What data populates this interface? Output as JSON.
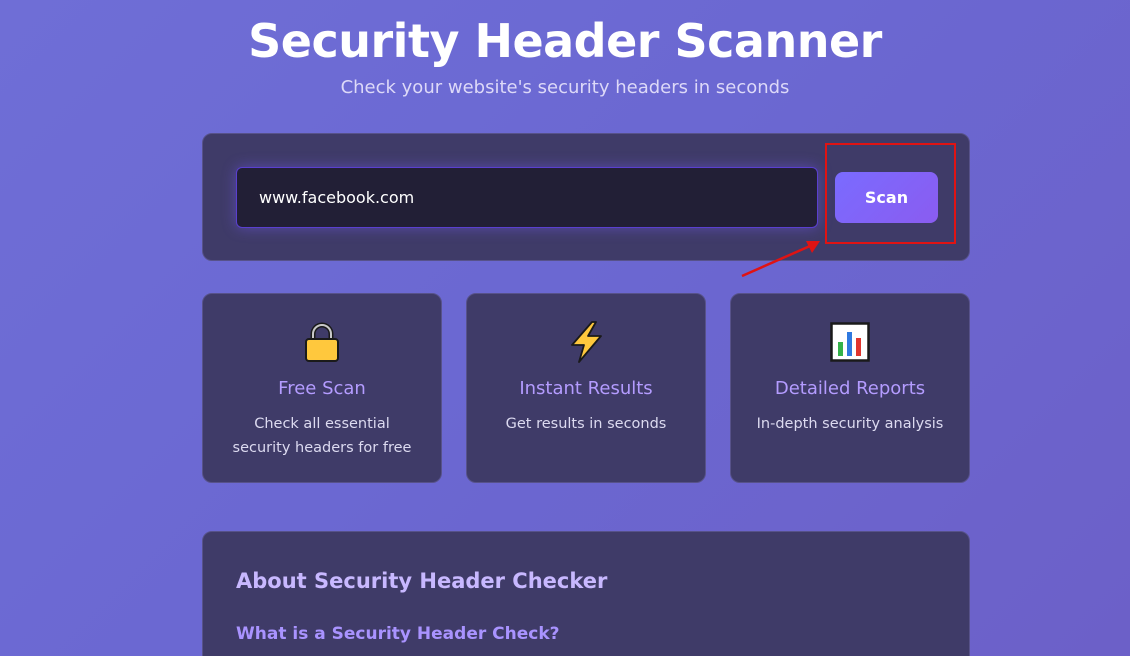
{
  "header": {
    "title": "Security Header Scanner",
    "subtitle": "Check your website's security headers in seconds"
  },
  "scan": {
    "url_value": "www.facebook.com",
    "button_label": "Scan"
  },
  "features": [
    {
      "icon": "lock-icon",
      "title": "Free Scan",
      "description": "Check all essential security headers for free"
    },
    {
      "icon": "lightning-icon",
      "title": "Instant Results",
      "description": "Get results in seconds"
    },
    {
      "icon": "bar-chart-icon",
      "title": "Detailed Reports",
      "description": "In-depth security analysis"
    }
  ],
  "about": {
    "title": "About Security Header Checker",
    "subheading": "What is a Security Header Check?"
  },
  "colors": {
    "accent": "#7a6bff",
    "feature_title": "#b49cff",
    "annotation": "#e01313"
  }
}
